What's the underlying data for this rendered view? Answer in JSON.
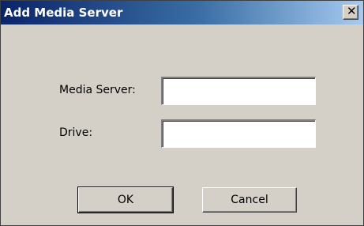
{
  "window": {
    "title": "Add Media Server",
    "close_glyph": "✕"
  },
  "form": {
    "media_server_label": "Media Server:",
    "media_server_value": "",
    "drive_label": "Drive:",
    "drive_value": ""
  },
  "buttons": {
    "ok_label": "OK",
    "cancel_label": "Cancel"
  }
}
